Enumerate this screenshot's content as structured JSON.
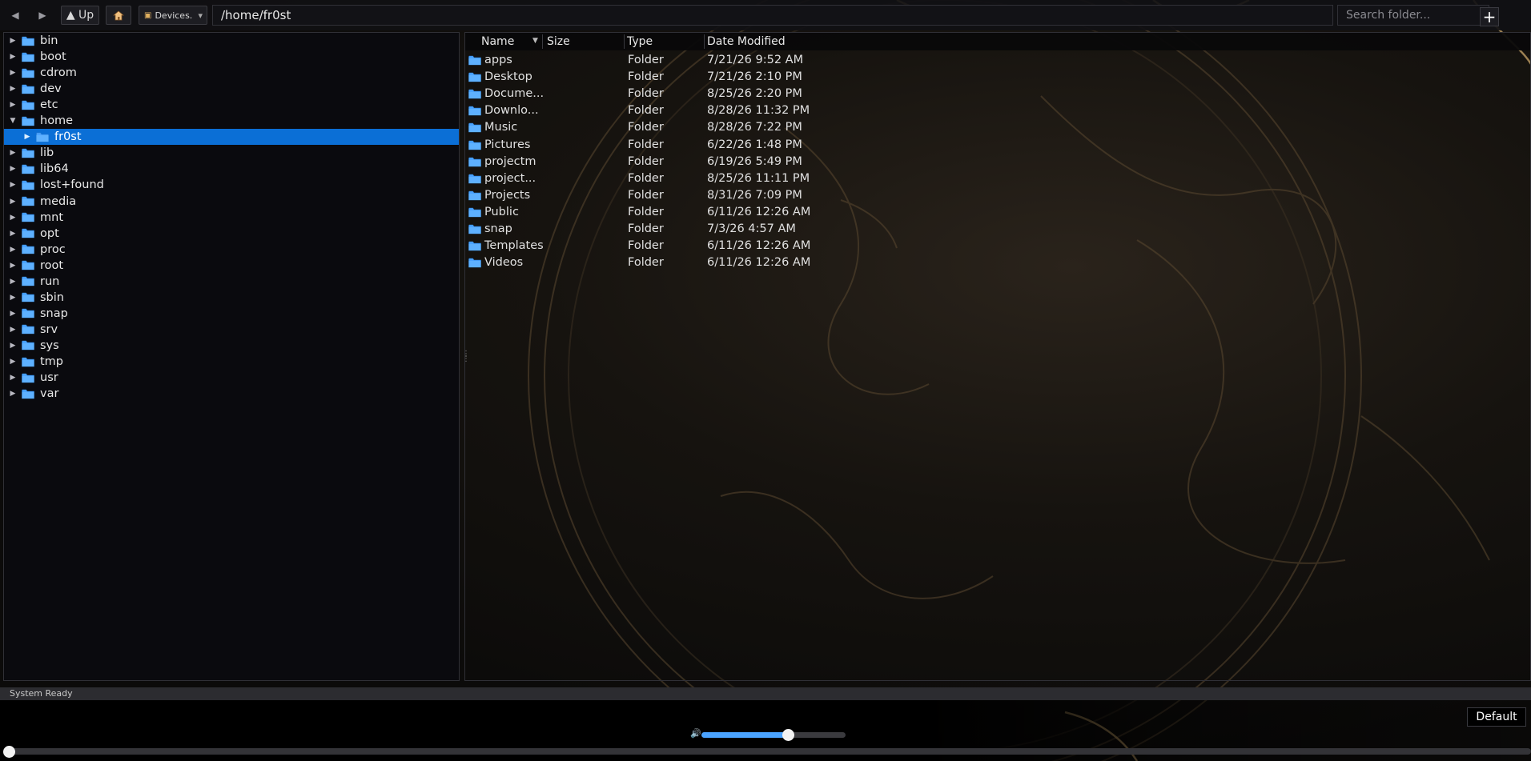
{
  "toolbar": {
    "back_icon": "back-arrow-icon",
    "forward_icon": "forward-arrow-icon",
    "up_label": "▲ Up",
    "home_icon": "home-icon",
    "devices_label": "Devices.",
    "devices_arrow": "▾",
    "path_value": "/home/fr0st",
    "search_placeholder": "Search folder...",
    "add_label": "+"
  },
  "tree": {
    "items": [
      {
        "label": "bin",
        "expanded": false
      },
      {
        "label": "boot",
        "expanded": false
      },
      {
        "label": "cdrom",
        "expanded": false
      },
      {
        "label": "dev",
        "expanded": false
      },
      {
        "label": "etc",
        "expanded": false
      },
      {
        "label": "home",
        "expanded": true
      },
      {
        "label": "fr0st",
        "expanded": false,
        "child": true,
        "selected": true
      },
      {
        "label": "lib",
        "expanded": false
      },
      {
        "label": "lib64",
        "expanded": false
      },
      {
        "label": "lost+found",
        "expanded": false
      },
      {
        "label": "media",
        "expanded": false
      },
      {
        "label": "mnt",
        "expanded": false
      },
      {
        "label": "opt",
        "expanded": false
      },
      {
        "label": "proc",
        "expanded": false
      },
      {
        "label": "root",
        "expanded": false
      },
      {
        "label": "run",
        "expanded": false
      },
      {
        "label": "sbin",
        "expanded": false
      },
      {
        "label": "snap",
        "expanded": false
      },
      {
        "label": "srv",
        "expanded": false
      },
      {
        "label": "sys",
        "expanded": false
      },
      {
        "label": "tmp",
        "expanded": false
      },
      {
        "label": "usr",
        "expanded": false
      },
      {
        "label": "var",
        "expanded": false
      }
    ]
  },
  "files": {
    "columns": {
      "name": "Name",
      "size": "Size",
      "type": "Type",
      "date": "Date Modified"
    },
    "rows": [
      {
        "name": "apps",
        "size": "",
        "type": "Folder",
        "date": "7/21/26 9:52 AM"
      },
      {
        "name": "Desktop",
        "size": "",
        "type": "Folder",
        "date": "7/21/26 2:10 PM"
      },
      {
        "name": "Docume...",
        "size": "",
        "type": "Folder",
        "date": "8/25/26 2:20 PM"
      },
      {
        "name": "Downlo...",
        "size": "",
        "type": "Folder",
        "date": "8/28/26 11:32 PM"
      },
      {
        "name": "Music",
        "size": "",
        "type": "Folder",
        "date": "8/28/26 7:22 PM"
      },
      {
        "name": "Pictures",
        "size": "",
        "type": "Folder",
        "date": "6/22/26 1:48 PM"
      },
      {
        "name": "projectm",
        "size": "",
        "type": "Folder",
        "date": "6/19/26 5:49 PM"
      },
      {
        "name": "project...",
        "size": "",
        "type": "Folder",
        "date": "8/25/26 11:11 PM"
      },
      {
        "name": "Projects",
        "size": "",
        "type": "Folder",
        "date": "8/31/26 7:09 PM"
      },
      {
        "name": "Public",
        "size": "",
        "type": "Folder",
        "date": "6/11/26 12:26 AM"
      },
      {
        "name": "snap",
        "size": "",
        "type": "Folder",
        "date": "7/3/26 4:57 AM"
      },
      {
        "name": "Templates",
        "size": "",
        "type": "Folder",
        "date": "6/11/26 12:26 AM"
      },
      {
        "name": "Videos",
        "size": "",
        "type": "Folder",
        "date": "6/11/26 12:26 AM"
      }
    ]
  },
  "status": {
    "text": "System Ready"
  },
  "player": {
    "default_label": "Default",
    "volume_icon": "speaker-icon",
    "volume_level": 0.6,
    "seek_position": 0.0
  },
  "colors": {
    "selection": "#0b6fd6",
    "folder": "#4aa3ff",
    "accent": "#4aa3ff"
  }
}
